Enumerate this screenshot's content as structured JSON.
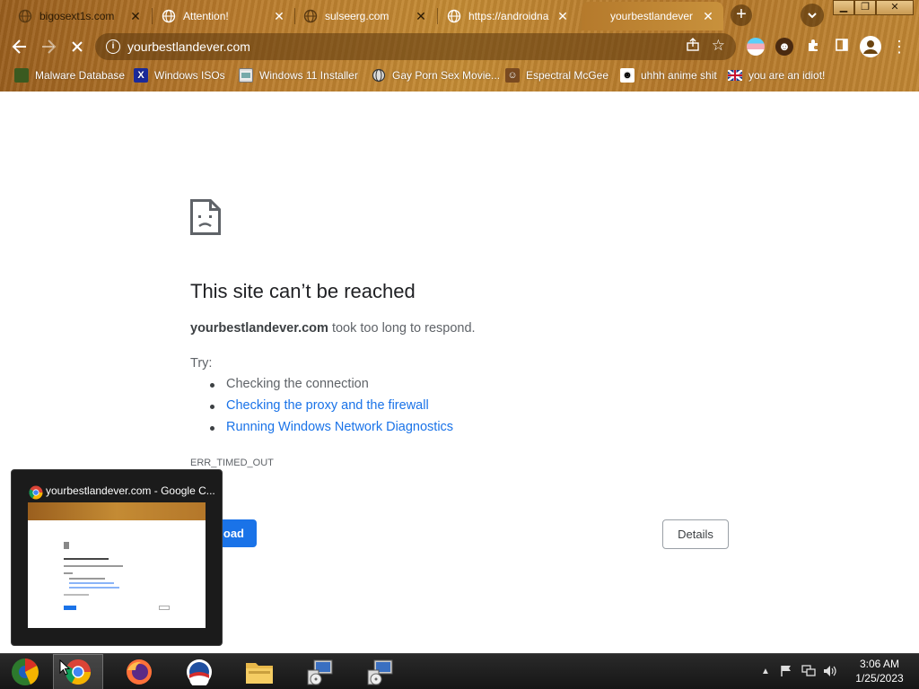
{
  "tabs": [
    {
      "title": "bigosext1s.com",
      "favicon": "globe-icon",
      "active": false
    },
    {
      "title": "Attention!",
      "favicon": "globe-icon",
      "active": false
    },
    {
      "title": "sulseerg.com",
      "favicon": "globe-icon",
      "active": false
    },
    {
      "title": "https://androidna",
      "favicon": "globe-icon",
      "active": false
    },
    {
      "title": "yourbestlandever",
      "favicon": "none",
      "active": true
    }
  ],
  "toolbar": {
    "url": "yourbestlandever.com"
  },
  "bookmarks": [
    {
      "label": "Malware Database",
      "icon": "malware-icon"
    },
    {
      "label": "Windows ISOs",
      "icon": "x-icon"
    },
    {
      "label": "Windows 11 Installer",
      "icon": "installer-icon"
    },
    {
      "label": "Gay Porn Sex Movie...",
      "icon": "globe-icon"
    },
    {
      "label": "Espectral McGee",
      "icon": "character-icon"
    },
    {
      "label": "uhhh anime shit",
      "icon": "anime-icon"
    },
    {
      "label": "you are an idiot!",
      "icon": "flag-icon"
    }
  ],
  "error": {
    "title": "This site can’t be reached",
    "domain": "yourbestlandever.com",
    "message": " took too long to respond.",
    "try_label": "Try:",
    "suggestions": [
      "Checking the connection",
      "Checking the proxy and the firewall",
      "Running Windows Network Diagnostics"
    ],
    "code": "ERR_TIMED_OUT",
    "reload_label": "oad",
    "details_label": "Details"
  },
  "preview": {
    "title": "yourbestlandever.com - Google C..."
  },
  "taskbar": {
    "time": "3:06 AM",
    "date": "1/25/2023"
  },
  "colors": {
    "link": "#1a73e8",
    "button": "#1a73e8",
    "frame": "#b87a2c"
  }
}
